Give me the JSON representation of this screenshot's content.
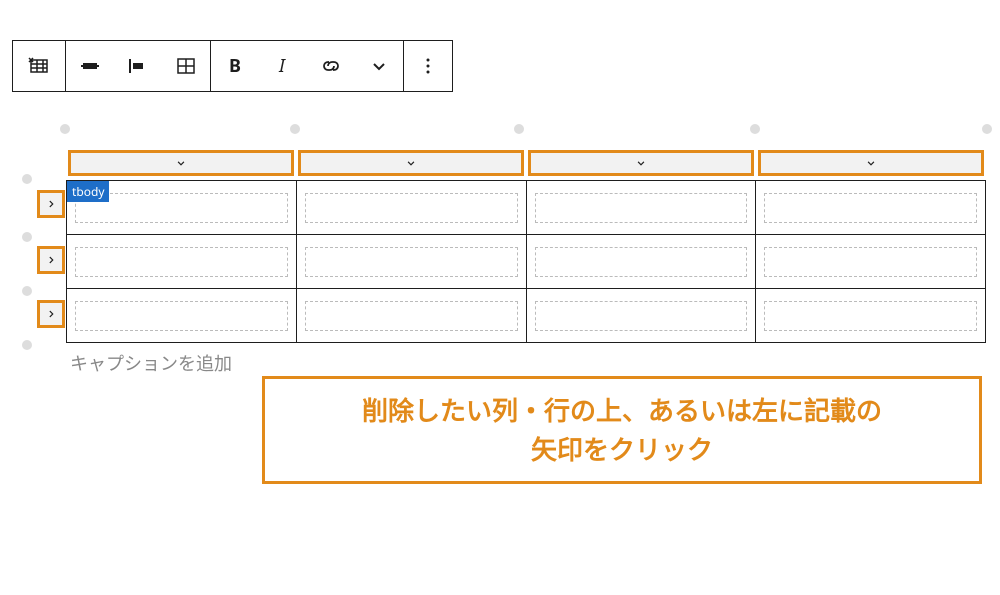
{
  "toolbar": {
    "icons": [
      "table-block",
      "align-none",
      "align-left",
      "edit-table",
      "bold",
      "italic",
      "link",
      "chevron-down",
      "more"
    ]
  },
  "table": {
    "cols": 4,
    "rows": 3,
    "tbody_label": "tbody",
    "caption_placeholder": "キャプションを追加"
  },
  "annotation": {
    "line1": "削除したい列・行の上、あるいは左に記載の",
    "line2": "矢印をクリック"
  },
  "colors": {
    "accent": "#e28a1a",
    "tag_bg": "#1e6ec8"
  }
}
